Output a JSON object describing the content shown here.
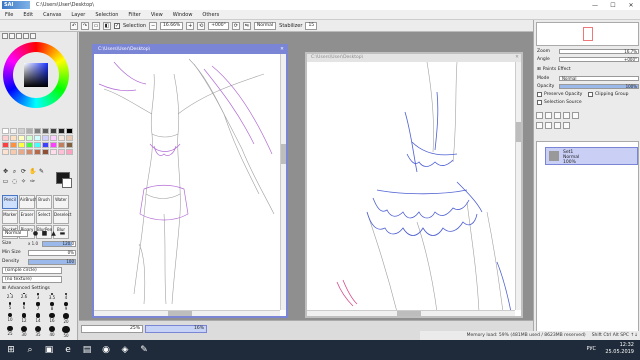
{
  "app": {
    "logo_text": "PaintTool SAI",
    "window_title": "C:\\Users\\User\\Desktop\\"
  },
  "window_controls": [
    "—",
    "☐",
    "✕"
  ],
  "menu": [
    "File",
    "Edit",
    "Canvas",
    "Layer",
    "Selection",
    "Filter",
    "View",
    "Window",
    "Others"
  ],
  "toolbar": {
    "selection_label": "Selection",
    "zoom": "16.66%",
    "angle": "+000°",
    "mode": "Normal",
    "stabilizer_label": "Stabilizer",
    "stabilizer_value": "15"
  },
  "left_panel": {
    "brush_tools": [
      "Pencil",
      "AirBrush",
      "Brush",
      "Water",
      "Marker",
      "Eraser",
      "Select",
      "Deselect",
      "Bucket",
      "Binary",
      "BlurPen",
      "Blur"
    ],
    "size_label": "Size",
    "size_mult": "x 1.0",
    "size_value": "120.0",
    "min_size_label": "Min Size",
    "min_size_value": "0%",
    "density_label": "Density",
    "density_value": "100",
    "shape_option": "(simple circle)",
    "texture_option": "(no texture)",
    "blend_mode": "Normal",
    "advanced_label": "Advanced Settings",
    "brush_sizes": [
      "2.3",
      "2.6",
      "3",
      "3.5",
      "4",
      "5",
      "6",
      "7",
      "8",
      "9",
      "10",
      "12",
      "14",
      "16",
      "20",
      "25",
      "30",
      "35",
      "40",
      "50",
      "60",
      "70",
      "80",
      "100",
      "120",
      "160",
      "200",
      "250",
      "300",
      "350"
    ]
  },
  "swatches": [
    "#ffffff",
    "#f0f0f0",
    "#d0d0d0",
    "#b0b0b0",
    "#808080",
    "#606060",
    "#404040",
    "#202020",
    "#000000",
    "#ffd0d0",
    "#ffe0c0",
    "#ffffc0",
    "#d0ffd0",
    "#d0ffff",
    "#d0d0ff",
    "#ffd0ff",
    "#f5e6dc",
    "#e8c8b0",
    "#ff4040",
    "#ff9040",
    "#ffff40",
    "#40ff40",
    "#40ffff",
    "#4040ff",
    "#ff40ff",
    "#c08060",
    "#806040",
    "#fde2d0",
    "#f7c9ad",
    "#e9a98a",
    "#d48a6a",
    "#b76a4a",
    "#8f4f35",
    "#ffdcec",
    "#ffc0d8",
    "#ffa0c0"
  ],
  "documents": [
    {
      "title": "C:\\Users\\User\\Desktop\\",
      "close": "✕"
    },
    {
      "title": "C:\\Users\\User\\Desktop\\",
      "close": "✕"
    }
  ],
  "navigator": [
    {
      "zoom": "25%"
    },
    {
      "zoom": "16%"
    }
  ],
  "right_panel": {
    "zoom_label": "Zoom",
    "zoom_value": "16.7%",
    "angle_label": "Angle",
    "angle_value": "+000°",
    "paper_effect": "Paints Effect",
    "mode_label": "Mode",
    "mode_value": "Normal",
    "opacity_label": "Opacity",
    "opacity_value": "100%",
    "preserve_opacity": "Preserve Opacity",
    "clipping_group": "Clipping Group",
    "selection_source": "Selection Source",
    "layer": {
      "name": "Set1",
      "mode": "Normal",
      "opacity": "100%"
    }
  },
  "status": {
    "memory": "Memory load: 59% (481MB used / 8623MB reserved)",
    "indicators": "Shift Ctrl Alt SPC ↑↓"
  },
  "taskbar": {
    "language": "РУС",
    "time": "12:32",
    "date": "25.05.2019"
  }
}
